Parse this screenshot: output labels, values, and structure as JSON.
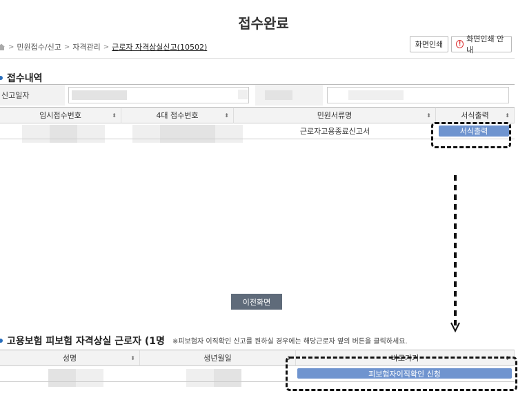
{
  "page": {
    "title": "접수완료"
  },
  "breadcrumb": {
    "items": [
      "민원접수/신고",
      "자격관리",
      "근로자 자격상실신고(10502)"
    ],
    "separator": ">"
  },
  "toolbar": {
    "print_label": "화면인쇄",
    "print_guide_label": "화면인쇄 안내",
    "warn_glyph": "!"
  },
  "section1": {
    "title": "접수내역",
    "report_date_label": "신고일자",
    "table": {
      "columns": [
        "임시접수번호",
        "4대 접수번호",
        "민원서류명",
        "서식출력"
      ],
      "rows": [
        {
          "doc_name": "근로자고용종료신고서",
          "action_label": "서식출력"
        }
      ]
    }
  },
  "prev_button_label": "이전화면",
  "section2": {
    "title": "고용보험 피보험 자격상실 근로자 (1명",
    "note": "※피보험자 이직확인 신고를 원하실 경우에는 해당근로자 옆의 버튼을 클릭하세요.",
    "table": {
      "columns": [
        "성명",
        "생년월일",
        "바로가기"
      ],
      "rows": [
        {
          "action_label": "피보험자이직확인 신청"
        }
      ]
    }
  },
  "sort_glyph": "⬍",
  "colors": {
    "accent_blue": "#6f94cf",
    "section_dot": "#2a6fbd",
    "warn_red": "#dd3333",
    "dark_button": "#5f6b7a"
  }
}
